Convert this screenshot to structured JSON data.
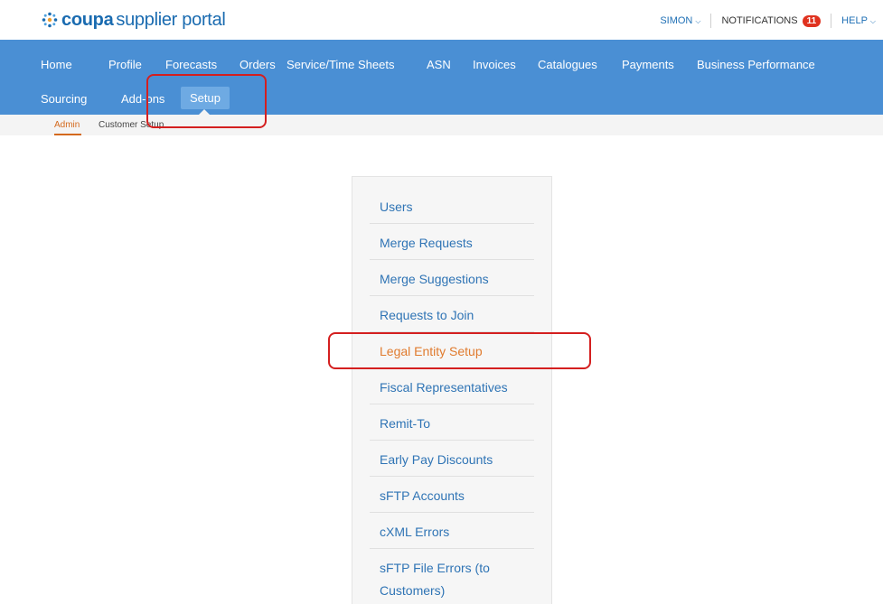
{
  "header": {
    "logo_bold": "coupa",
    "logo_rest": "supplier portal",
    "user_label": "SIMON",
    "notifications_label": "NOTIFICATIONS",
    "notifications_count": "11",
    "help_label": "HELP"
  },
  "nav": {
    "items": [
      "Home",
      "Profile",
      "Forecasts",
      "Orders",
      "Service/Time Sheets",
      "ASN",
      "Invoices",
      "Catalogues",
      "Payments",
      "Business Performance",
      "Sourcing",
      "Add-ons",
      "Setup"
    ],
    "active": "Setup"
  },
  "subnav": {
    "items": [
      "Admin",
      "Customer Setup"
    ],
    "active": "Admin"
  },
  "menu": {
    "items": [
      "Users",
      "Merge Requests",
      "Merge Suggestions",
      "Requests to Join",
      "Legal Entity Setup",
      "Fiscal Representatives",
      "Remit-To",
      "Early Pay Discounts",
      "sFTP Accounts",
      "cXML Errors",
      "sFTP File Errors (to",
      "Customers)"
    ],
    "active": "Legal Entity Setup"
  },
  "colors": {
    "brand_blue": "#4a8fd4",
    "link_blue": "#2f74b5",
    "active_orange": "#e07b2e",
    "highlight_red": "#d41f1f",
    "badge_red": "#e0321f"
  },
  "icons": [
    "coupa-logo-icon",
    "chevron-down-icon"
  ]
}
